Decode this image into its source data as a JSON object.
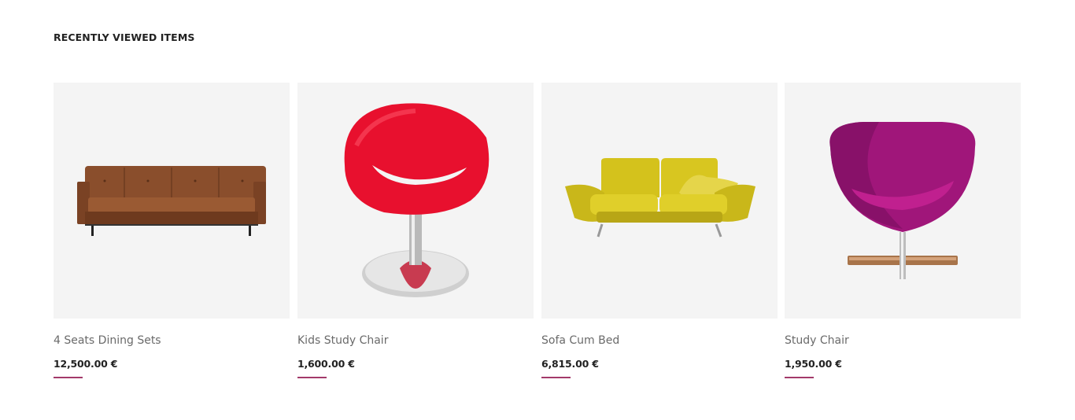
{
  "section": {
    "title": "RECENTLY VIEWED ITEMS"
  },
  "products": [
    {
      "name": "4 Seats Dining Sets",
      "price": "12,500.00 €",
      "image": "brown-leather-sofa"
    },
    {
      "name": "Kids Study Chair",
      "price": "1,600.00 €",
      "image": "red-swivel-chair"
    },
    {
      "name": "Sofa Cum Bed",
      "price": "6,815.00 €",
      "image": "yellow-sofa"
    },
    {
      "name": "Study Chair",
      "price": "1,950.00 €",
      "image": "purple-egg-chair"
    }
  ],
  "colors": {
    "accent": "#a33a6a",
    "image_bg": "#f4f4f4"
  }
}
